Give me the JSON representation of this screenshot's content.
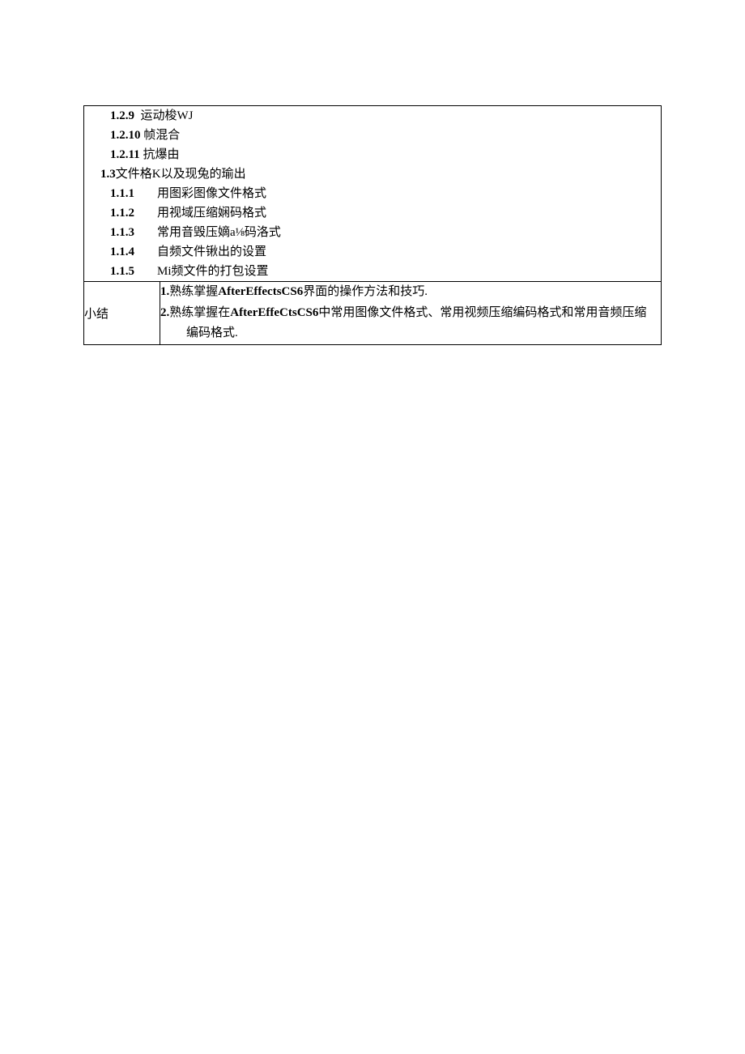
{
  "toc": {
    "l129": {
      "num": "1.2.9",
      "text": "运动梭WJ"
    },
    "l1210": {
      "num": "1.2.10",
      "text": "帧混合"
    },
    "l1211": {
      "num": "1.2.11",
      "text": "抗爆由"
    },
    "l13": {
      "num": "1.3",
      "text": "文件格K以及现兔的瑜出"
    },
    "items": [
      {
        "num": "1.1.1",
        "text": "用图彩图像文件格式"
      },
      {
        "num": "1.1.2",
        "text": "用视域压缩娴码格式"
      },
      {
        "num": "1.1.3",
        "text": "常用音毁压嫡a⅛码洛式"
      },
      {
        "num": "1.1.4",
        "text": "自频文件锹出的设置"
      },
      {
        "num": "1.1.5",
        "text": "Mi频文件的打包设置"
      }
    ]
  },
  "summary": {
    "label": "小结",
    "p1_prefix": "1.",
    "p1_a": "熟练掌握",
    "p1_b": "AfterEffectsCS6",
    "p1_c": "界面的操作方法和技巧.",
    "p2_prefix": "2.",
    "p2_a": "熟练掌握在",
    "p2_b": "AfterEffeCtsCS6",
    "p2_c": "中常用图像文件格式、常用视频压缩编码格式和常用音频压缩",
    "p2_d": "编码格式."
  }
}
